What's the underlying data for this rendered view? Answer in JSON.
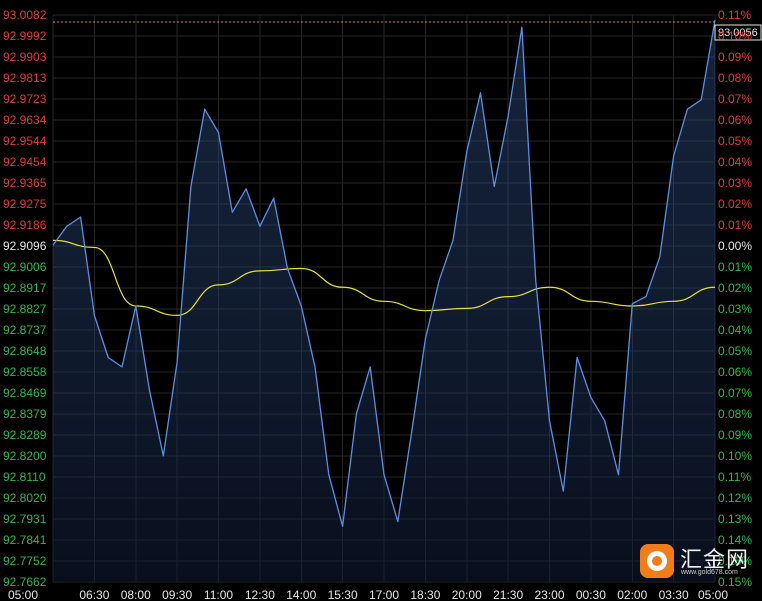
{
  "chart_data": {
    "type": "line",
    "title": "",
    "xlabel": "",
    "ylabel": "",
    "reference_price": 92.9096,
    "last_price_label": "93.0056",
    "ylim": [
      92.7662,
      93.0082
    ],
    "y_ticks": [
      "93.0082",
      "92.9992",
      "92.9903",
      "92.9813",
      "92.9723",
      "92.9634",
      "92.9544",
      "92.9454",
      "92.9365",
      "92.9275",
      "92.9186",
      "92.9096",
      "92.9006",
      "92.8917",
      "92.8827",
      "92.8737",
      "92.8648",
      "92.8558",
      "92.8469",
      "92.8379",
      "92.8289",
      "92.8200",
      "92.8110",
      "92.8020",
      "92.7931",
      "92.7841",
      "92.7752",
      "92.7662"
    ],
    "y_ticks_right": [
      "0.11%",
      "0.10%",
      "0.09%",
      "0.08%",
      "0.07%",
      "0.06%",
      "0.05%",
      "0.04%",
      "0.03%",
      "0.02%",
      "0.01%",
      "0.00%",
      "0.01%",
      "0.02%",
      "0.03%",
      "0.04%",
      "0.05%",
      "0.06%",
      "0.07%",
      "0.08%",
      "0.09%",
      "0.10%",
      "0.11%",
      "0.12%",
      "0.13%",
      "0.14%",
      "0.15%",
      "0.15%"
    ],
    "x_ticks": [
      "05:00",
      "06:30",
      "08:00",
      "09:30",
      "11:00",
      "12:30",
      "14:00",
      "15:30",
      "17:00",
      "18:30",
      "20:00",
      "21:30",
      "23:00",
      "00:30",
      "02:00",
      "03:30",
      "05:00"
    ],
    "series": [
      {
        "role": "price",
        "x": [
          "05:00",
          "05:30",
          "06:00",
          "06:30",
          "07:00",
          "07:30",
          "08:00",
          "08:30",
          "09:00",
          "09:30",
          "10:00",
          "10:30",
          "11:00",
          "11:30",
          "12:00",
          "12:30",
          "13:00",
          "13:30",
          "14:00",
          "14:30",
          "15:00",
          "15:30",
          "16:00",
          "16:30",
          "17:00",
          "17:30",
          "18:00",
          "18:30",
          "19:00",
          "19:30",
          "20:00",
          "20:30",
          "21:00",
          "21:30",
          "22:00",
          "22:30",
          "23:00",
          "23:30",
          "00:00",
          "00:30",
          "01:00",
          "01:30",
          "02:00",
          "02:30",
          "03:00",
          "03:30",
          "04:00",
          "04:30",
          "05:00"
        ],
        "values": [
          92.91,
          92.918,
          92.922,
          92.88,
          92.862,
          92.858,
          92.884,
          92.848,
          92.82,
          92.86,
          92.935,
          92.968,
          92.958,
          92.924,
          92.934,
          92.918,
          92.93,
          92.9,
          92.884,
          92.858,
          92.812,
          92.79,
          92.838,
          92.858,
          92.812,
          92.792,
          92.83,
          92.87,
          92.895,
          92.912,
          92.95,
          92.975,
          92.935,
          92.965,
          93.003,
          92.895,
          92.835,
          92.805,
          92.862,
          92.845,
          92.835,
          92.812,
          92.885,
          92.888,
          92.905,
          92.948,
          92.968,
          92.972,
          93.006
        ]
      },
      {
        "role": "average",
        "x": [
          "05:00",
          "06:30",
          "08:00",
          "09:30",
          "11:00",
          "12:30",
          "14:00",
          "15:30",
          "17:00",
          "18:30",
          "20:00",
          "21:30",
          "23:00",
          "00:30",
          "02:00",
          "03:30",
          "05:00"
        ],
        "values": [
          92.912,
          92.909,
          92.884,
          92.88,
          92.893,
          92.899,
          92.9,
          92.892,
          92.886,
          92.882,
          92.883,
          92.888,
          92.892,
          92.886,
          92.884,
          92.886,
          92.892
        ]
      }
    ],
    "colors": {
      "price_line": "#5b8fe0",
      "average_line": "#e6e03a",
      "axis_up": "#e03a3a",
      "axis_down": "#2fb84a",
      "axis_neutral": "#e6e6e6",
      "reference_line": "#e08a3a"
    }
  },
  "watermark": {
    "name": "汇金网",
    "url": "www.gold678.com",
    "icon": "gold678-logo-icon"
  }
}
